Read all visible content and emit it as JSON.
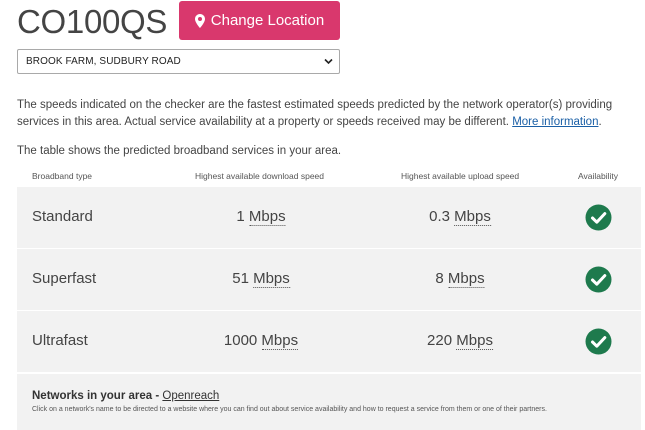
{
  "header": {
    "postcode": "CO100QS",
    "change_button_label": "Change Location"
  },
  "address_select": {
    "selected": "BROOK FARM, SUDBURY ROAD"
  },
  "disclaimer": {
    "text": "The speeds indicated on the checker are the fastest estimated speeds predicted by the network operator(s) providing services in this area. Actual service availability at a property or speeds received may be different.",
    "link_label": "More information",
    "end": "."
  },
  "intro": "The table shows the predicted broadband services in your area.",
  "table": {
    "headers": {
      "type": "Broadband type",
      "download": "Highest available download speed",
      "upload": "Highest available upload speed",
      "availability": "Availability"
    },
    "rows": [
      {
        "type": "Standard",
        "download": "1",
        "upload": "0.3",
        "unit": "Mbps",
        "available": true
      },
      {
        "type": "Superfast",
        "download": "51",
        "upload": "8",
        "unit": "Mbps",
        "available": true
      },
      {
        "type": "Ultrafast",
        "download": "1000",
        "upload": "220",
        "unit": "Mbps",
        "available": true
      }
    ]
  },
  "networks": {
    "title": "Networks in your area",
    "separator": " - ",
    "operator_link": "Openreach",
    "note": "Click on a network's name to be directed to a website where you can find out about service availability and how to request a service from them or one of their partners."
  },
  "colors": {
    "accent": "#d9386d",
    "available": "#1e7a4d",
    "link": "#1a5fa6"
  },
  "icons": {
    "button": "map-marker-icon",
    "select": "chevron-down-icon",
    "availability": "check-circle-icon"
  }
}
